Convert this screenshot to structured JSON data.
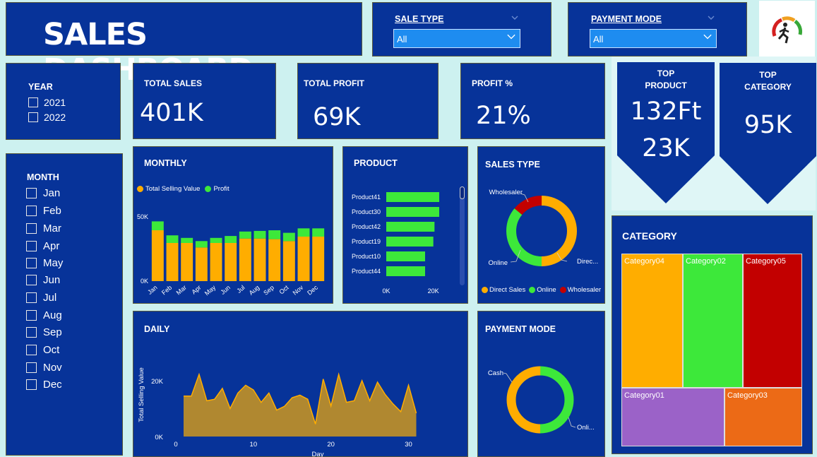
{
  "title": "SALES DASHBOARD",
  "sale_type_slicer": {
    "label": "SALE TYPE",
    "value": "All"
  },
  "payment_mode_slicer": {
    "label": "PAYMENT MODE",
    "value": "All"
  },
  "year_slicer": {
    "label": "YEAR",
    "options": [
      "2021",
      "2022"
    ]
  },
  "month_slicer": {
    "label": "MONTH",
    "options": [
      "Jan",
      "Feb",
      "Mar",
      "Apr",
      "May",
      "Jun",
      "Jul",
      "Aug",
      "Sep",
      "Oct",
      "Nov",
      "Dec"
    ]
  },
  "kpis": {
    "total_sales": {
      "label": "TOTAL SALES",
      "value": "401K"
    },
    "total_profit": {
      "label": "TOTAL PROFIT",
      "value": "69K"
    },
    "profit_pct": {
      "label": "PROFIT %",
      "value": "21%"
    },
    "top_product": {
      "label_line1": "TOP",
      "label_line2": "PRODUCT",
      "name": "132Ft",
      "value": "23K"
    },
    "top_category": {
      "label_line1": "TOP",
      "label_line2": "CATEGORY",
      "value": "95K"
    }
  },
  "colors": {
    "panel": "#073399",
    "orange": "#ffad00",
    "green": "#3de83a",
    "red": "#c20000",
    "purple": "#9b62c8",
    "dark_orange": "#ec6a16",
    "area": "#b08830"
  },
  "chart_data": [
    {
      "id": "monthly",
      "type": "bar",
      "title": "MONTHLY",
      "stacked": true,
      "categories": [
        "Jan",
        "Feb",
        "Mar",
        "Apr",
        "May",
        "Jun",
        "Jul",
        "Aug",
        "Sep",
        "Oct",
        "Nov",
        "Dec"
      ],
      "series": [
        {
          "name": "Total Selling Value",
          "color": "#ffad00",
          "values": [
            40000,
            30000,
            30000,
            26500,
            30000,
            30000,
            33500,
            33500,
            33000,
            31500,
            35000,
            35000
          ]
        },
        {
          "name": "Profit",
          "color": "#3de83a",
          "values": [
            7000,
            6000,
            4000,
            5000,
            4000,
            5500,
            5500,
            6000,
            7000,
            6500,
            6500,
            6500
          ]
        }
      ],
      "yticks": [
        "50K",
        "0K"
      ],
      "ylim": [
        0,
        50000
      ],
      "legend": "top-left"
    },
    {
      "id": "product",
      "type": "bar",
      "orientation": "horizontal",
      "title": "PRODUCT",
      "categories": [
        "Product41",
        "Product30",
        "Product42",
        "Product19",
        "Product10",
        "Product44"
      ],
      "values": [
        22500,
        22500,
        20500,
        20000,
        16500,
        16500
      ],
      "xticks": [
        "0K",
        "20K"
      ],
      "xlim": [
        0,
        22500
      ]
    },
    {
      "id": "sales_type",
      "type": "pie",
      "donut": true,
      "title": "SALES TYPE",
      "categories": [
        "Direct Sales",
        "Online",
        "Wholesaler"
      ],
      "values": [
        50,
        36,
        14
      ],
      "slice_labels": [
        "Direc...",
        "Online",
        "Wholesaler"
      ],
      "legend": "bottom"
    },
    {
      "id": "daily",
      "type": "area",
      "title": "DAILY",
      "x": [
        1,
        2,
        3,
        4,
        5,
        6,
        7,
        8,
        9,
        10,
        11,
        12,
        13,
        14,
        15,
        16,
        17,
        18,
        19,
        20,
        21,
        22,
        23,
        24,
        25,
        26,
        27,
        28,
        29,
        30,
        31
      ],
      "values": [
        13000,
        13000,
        20000,
        11500,
        12000,
        15500,
        9000,
        14000,
        16500,
        15000,
        11000,
        14000,
        8500,
        9700,
        12500,
        13300,
        12000,
        4000,
        18500,
        9800,
        20000,
        11000,
        11500,
        18000,
        11500,
        17500,
        13500,
        10500,
        8000,
        16500,
        7500
      ],
      "xlabel": "Day",
      "ylabel": "Total Selling Value",
      "xticks": [
        "0",
        "10",
        "20",
        "30"
      ],
      "yticks": [
        "20K",
        "0K"
      ],
      "xlim": [
        0,
        31.5
      ],
      "ylim": [
        0,
        25000
      ]
    },
    {
      "id": "payment_mode",
      "type": "pie",
      "donut": true,
      "title": "PAYMENT MODE",
      "categories": [
        "Online",
        "Cash"
      ],
      "values": [
        50,
        50
      ],
      "slice_labels": [
        "Onli...",
        "Cash"
      ]
    },
    {
      "id": "category",
      "type": "treemap",
      "title": "CATEGORY",
      "categories": [
        "Category04",
        "Category02",
        "Category05",
        "Category01",
        "Category03"
      ],
      "values": [
        95,
        85,
        84,
        82,
        62
      ]
    }
  ]
}
